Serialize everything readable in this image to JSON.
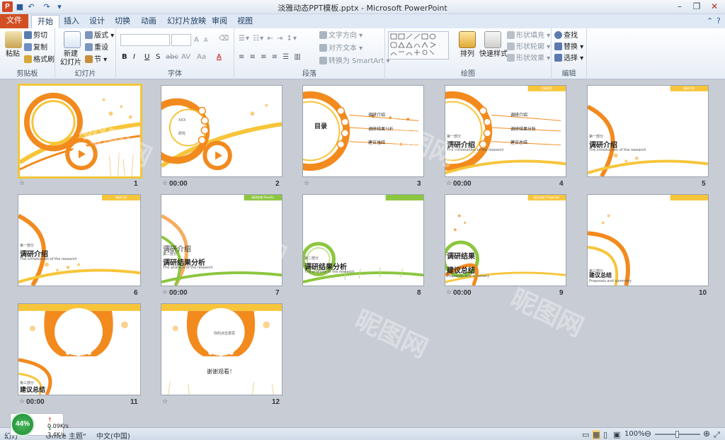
{
  "window": {
    "title": "淡雅动态PPT模板.pptx - Microsoft PowerPoint",
    "app_icon": "P"
  },
  "tabs": [
    "文件",
    "开始",
    "插入",
    "设计",
    "切换",
    "动画",
    "幻灯片放映",
    "审阅",
    "视图"
  ],
  "active_tab": "开始",
  "ribbon": {
    "clipboard": {
      "label": "剪贴板",
      "paste": "粘贴",
      "cut": "剪切",
      "copy": "复制",
      "format_painter": "格式刷"
    },
    "slides": {
      "label": "幻灯片",
      "new_slide": "新建",
      "new_slide2": "幻灯片",
      "layout": "版式",
      "reset": "重设",
      "section": "节"
    },
    "font": {
      "label": "字体",
      "bold": "B",
      "italic": "I",
      "underline": "U",
      "strike": "S",
      "shadow": "abc",
      "spacing": "AV",
      "case": "Aa",
      "grow": "A",
      "shrink": "A"
    },
    "paragraph": {
      "label": "段落",
      "text_direction": "文字方向",
      "align_text": "对齐文本",
      "smartart": "转换为 SmartArt"
    },
    "drawing": {
      "label": "绘图",
      "arrange": "排列",
      "quick_styles": "快速样式",
      "shape_fill": "形状填充",
      "shape_outline": "形状轮廓",
      "shape_effects": "形状效果"
    },
    "editing": {
      "label": "编辑",
      "find": "查找",
      "replace": "替换",
      "select": "选择"
    }
  },
  "slides": [
    {
      "num": "1",
      "time": "",
      "selected": true
    },
    {
      "num": "2",
      "time": "00:00"
    },
    {
      "num": "3",
      "time": ""
    },
    {
      "num": "4",
      "time": "00:00"
    },
    {
      "num": "5",
      "time": ""
    },
    {
      "num": "6",
      "time": ""
    },
    {
      "num": "7",
      "time": "00:00"
    },
    {
      "num": "8",
      "time": ""
    },
    {
      "num": "9",
      "time": "00:00"
    },
    {
      "num": "10",
      "time": ""
    },
    {
      "num": "11",
      "time": "00:00"
    },
    {
      "num": "12",
      "time": ""
    }
  ],
  "slide_text": {
    "s2_a": "XXX",
    "s2_b": "研究",
    "s3_title": "目录",
    "s3_m1": "调研介绍",
    "s3_m2": "调研结果分析",
    "s3_m3": "建议总结",
    "s4_tag": "目录规范",
    "s4_part": "第一部分",
    "s4_title": "调研介绍",
    "s4_sub": "The introduction of the research",
    "s5_tag": "调研介绍",
    "s5_part": "第一部分",
    "s5_title": "调研介绍",
    "s5_sub": "The introduction of the research",
    "s6_tag": "调研介绍",
    "s6_part": "第一部分",
    "s6_title": "调研介绍",
    "s6_sub": "The introduction of the research",
    "s7_tag": "调研结果 Results",
    "s7_part": "第二部分",
    "s7_title": "调研结果分析",
    "s7_sub": "The analysis of the research",
    "s7_ghost": "调研介绍",
    "s8_part": "第二部分",
    "s8_title": "调研结果分析",
    "s8_sub": "The analysis of the research",
    "s9_tag": "建议总结 Proposals",
    "s9_title": "调研结果",
    "s9_title2": "建议总结",
    "s9_sub": "Proposals and summary",
    "s10_part": "第三部分",
    "s10_title": "建议总结",
    "s10_sub": "Proposals and summary",
    "s11_part": "第三部分",
    "s11_title": "建议总结",
    "s12_top": "你的点击意思",
    "s12_thanks": "谢谢观看！"
  },
  "status": {
    "slide_info": "幻灯",
    "theme": "\"Office 主题\"",
    "lang": "中文(中国)",
    "zoom": "100%"
  },
  "network": {
    "percent": "44%",
    "up": "0.09K/s",
    "down": "3.4K/s"
  },
  "watermark": "昵图网",
  "colors": {
    "orange": "#f28a1e",
    "yellow": "#f7c53a",
    "green": "#8cc63f",
    "file_tab": "#d24f24"
  }
}
